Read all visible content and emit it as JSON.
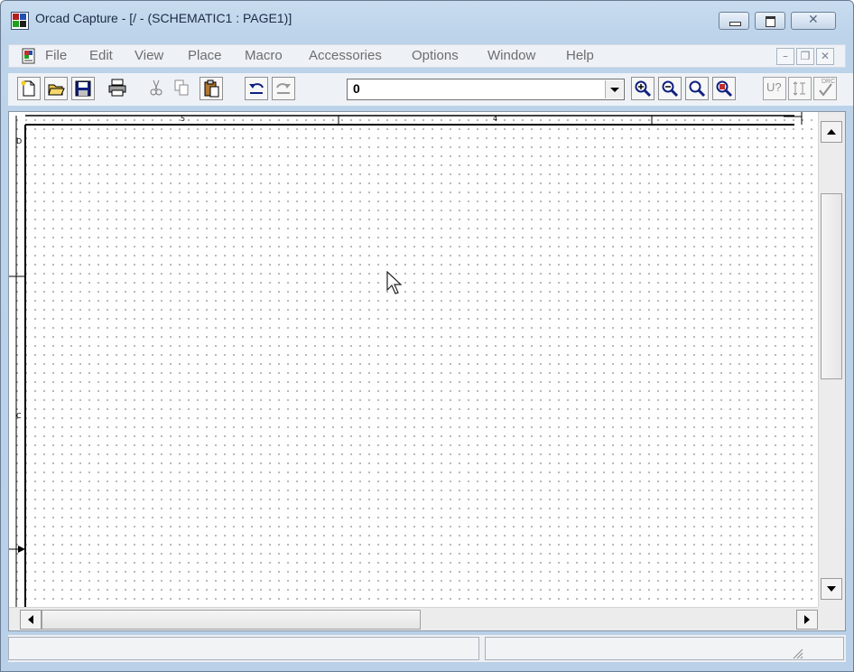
{
  "window": {
    "title": "Orcad Capture - [/ - (SCHEMATIC1 : PAGE1)]"
  },
  "menubar": {
    "items": [
      "File",
      "Edit",
      "View",
      "Place",
      "Macro",
      "Accessories",
      "Options",
      "Window",
      "Help"
    ]
  },
  "toolbar": {
    "combo_value": "0",
    "buttons": [
      "new-icon",
      "open-icon",
      "save-icon",
      "print-icon",
      "cut-icon",
      "copy-icon",
      "paste-icon",
      "undo-icon",
      "redo-icon",
      "zoom-in-icon",
      "zoom-out-icon",
      "zoom-area-icon",
      "zoom-all-icon",
      "annotate-icon",
      "back-annotate-icon",
      "drc-icon"
    ],
    "drc_label": "DRC",
    "annotate_label": "U?"
  },
  "schematic": {
    "border_labels": [
      "5",
      "4"
    ],
    "left_labels": [
      "D",
      "C"
    ]
  },
  "status": {
    "panel1": "",
    "panel2": ""
  }
}
